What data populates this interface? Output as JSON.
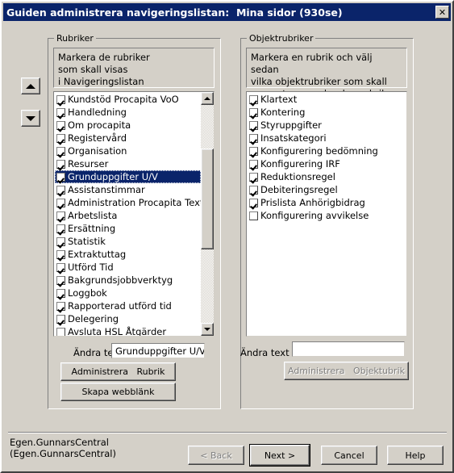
{
  "window": {
    "title": "Guiden administrera navigeringslistan:  Mina sidor (930se)",
    "close_icon": "✕"
  },
  "move_buttons": {
    "up": "move-up",
    "down": "move-down"
  },
  "left_panel": {
    "legend": "Rubriker",
    "description": "Markera  de rubriker\n som skall visas\n i Navigeringslistan",
    "items": [
      {
        "label": "Kundstöd Procapita VoO",
        "checked": true,
        "selected": false
      },
      {
        "label": "Handledning",
        "checked": true,
        "selected": false
      },
      {
        "label": "Om procapita",
        "checked": true,
        "selected": false
      },
      {
        "label": "Registervård",
        "checked": true,
        "selected": false
      },
      {
        "label": "Organisation",
        "checked": true,
        "selected": false
      },
      {
        "label": "Resurser",
        "checked": true,
        "selected": false
      },
      {
        "label": "Grunduppgifter U/V",
        "checked": true,
        "selected": true
      },
      {
        "label": "Assistanstimmar",
        "checked": true,
        "selected": false
      },
      {
        "label": "Administration Procapita Text",
        "checked": true,
        "selected": false
      },
      {
        "label": "Arbetslista",
        "checked": true,
        "selected": false
      },
      {
        "label": "Ersättning",
        "checked": true,
        "selected": false
      },
      {
        "label": "Statistik",
        "checked": true,
        "selected": false
      },
      {
        "label": "Extraktuttag",
        "checked": true,
        "selected": false
      },
      {
        "label": "Utförd Tid",
        "checked": true,
        "selected": false
      },
      {
        "label": "Bakgrundsjobbverktyg",
        "checked": true,
        "selected": false
      },
      {
        "label": "Loggbok",
        "checked": true,
        "selected": false
      },
      {
        "label": "Rapporterad utförd tid",
        "checked": true,
        "selected": false
      },
      {
        "label": "Delegering",
        "checked": true,
        "selected": false
      },
      {
        "label": "Avsluta HSL Åtgärder",
        "checked": false,
        "selected": false
      }
    ],
    "edit_label": "Ändra text",
    "edit_value": "Grunduppgifter U/V",
    "edit_placeholder": "",
    "admin_button": "Administrera   Rubrik",
    "weblink_button": "Skapa webblänk"
  },
  "right_panel": {
    "legend": "Objektrubriker",
    "description": "Markera en rubrik och välj sedan\nvilka objektrubriker som skall\npresenteras under den rubriken",
    "items": [
      {
        "label": "Klartext",
        "checked": true
      },
      {
        "label": "Kontering",
        "checked": true
      },
      {
        "label": "Styruppgifter",
        "checked": true
      },
      {
        "label": "Insatskategori",
        "checked": true
      },
      {
        "label": "Konfigurering bedömning",
        "checked": true
      },
      {
        "label": "Konfigurering IRF",
        "checked": true
      },
      {
        "label": "Reduktionsregel",
        "checked": true
      },
      {
        "label": "Debiteringsregel",
        "checked": true
      },
      {
        "label": "Prislista Anhörigbidrag",
        "checked": true
      },
      {
        "label": "Konfigurering avvikelse",
        "checked": false
      }
    ],
    "edit_label": "Ändra text",
    "edit_value": "",
    "edit_placeholder": "",
    "admin_button": "Administrera   Objektubrik",
    "admin_button_disabled": true
  },
  "footer": {
    "status": "Egen.GunnarsCentral\n(Egen.GunnarsCentral)",
    "back_button": "< Back",
    "next_button": "Next >",
    "cancel_button": "Cancel",
    "help_button": "Help"
  },
  "colors": {
    "titlebar": "#0a246a",
    "face": "#d4d0c8",
    "selection": "#0a246a",
    "disabled_text": "#808080"
  }
}
